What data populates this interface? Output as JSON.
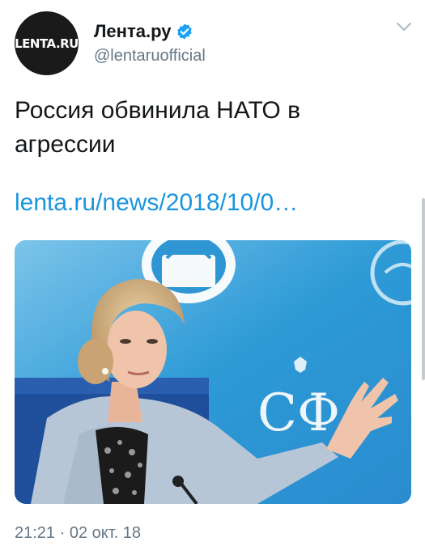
{
  "account": {
    "avatar_text": "LENTA.RU",
    "display_name": "Лента.ру",
    "handle": "@lentaruofficial"
  },
  "tweet": {
    "text": "Россия обвинила НАТО в агрессии",
    "link": "lenta.ru/news/2018/10/0…",
    "timestamp": "21:21 · 02 окт. 18",
    "media": {
      "backdrop_text": "СФ"
    }
  },
  "icons": {
    "verified": "verified-badge-icon",
    "menu": "chevron-down-icon"
  },
  "colors": {
    "link": "#1b95e0",
    "verified": "#1da1f2",
    "secondary_text": "#657786",
    "media_background": "#2fa3d8"
  }
}
